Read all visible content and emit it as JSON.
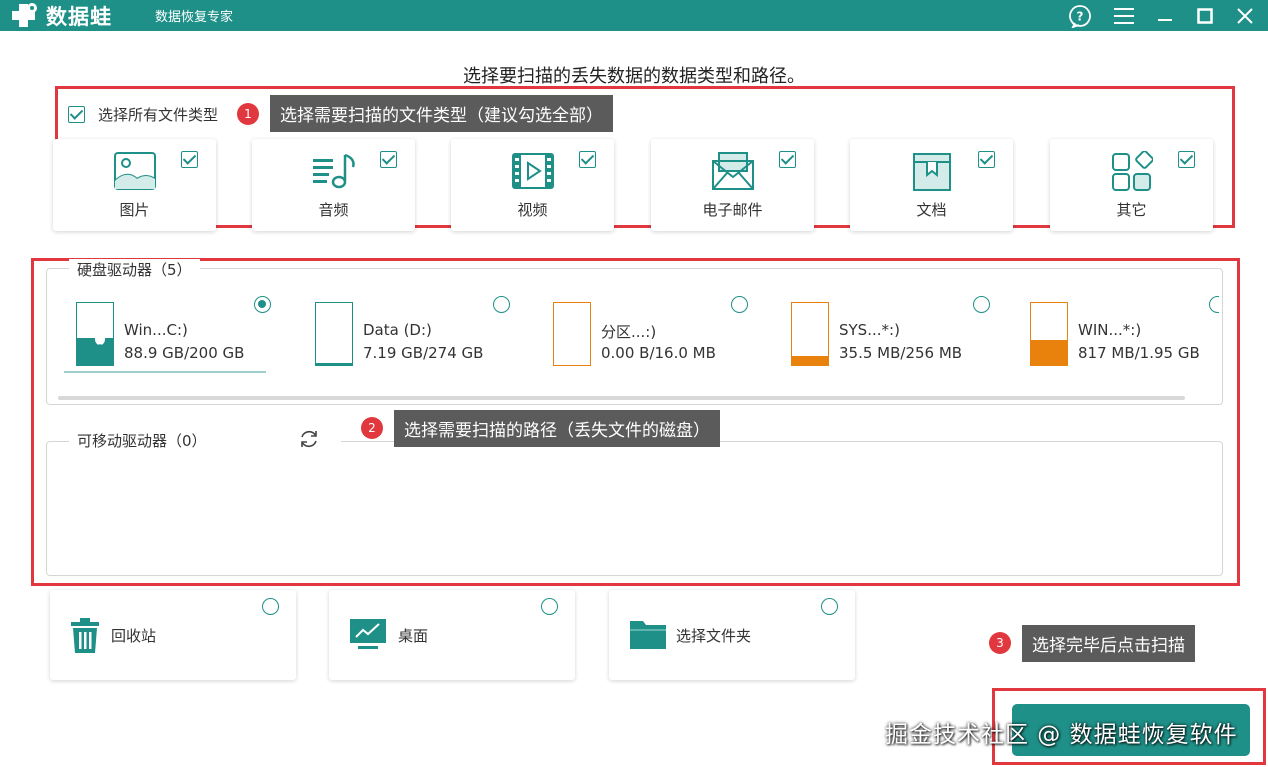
{
  "app": {
    "logo_text": "数据蛙",
    "subtitle": "数据恢复专家"
  },
  "heading": "选择要扫描的丢失数据的数据类型和路径。",
  "file_types": {
    "select_all_label": "选择所有文件类型",
    "select_all_checked": true,
    "items": [
      {
        "label": "图片",
        "icon": "image-icon",
        "checked": true
      },
      {
        "label": "音频",
        "icon": "audio-icon",
        "checked": true
      },
      {
        "label": "视频",
        "icon": "video-icon",
        "checked": true
      },
      {
        "label": "电子邮件",
        "icon": "email-icon",
        "checked": true
      },
      {
        "label": "文档",
        "icon": "document-icon",
        "checked": true
      },
      {
        "label": "其它",
        "icon": "other-icon",
        "checked": true
      }
    ]
  },
  "hard_drives": {
    "title": "硬盘驱动器（5）",
    "items": [
      {
        "name": "Win...C:)",
        "size": "88.9 GB/200 GB",
        "used_fraction": 0.44,
        "color": "#1e9088",
        "selected": true
      },
      {
        "name": "Data (D:)",
        "size": "7.19 GB/274 GB",
        "used_fraction": 0.03,
        "color": "#1e9088",
        "selected": false
      },
      {
        "name": "分区...:)",
        "size": "0.00  B/16.0 MB",
        "used_fraction": 0.0,
        "color": "#e8820c",
        "selected": false
      },
      {
        "name": "SYS...*:)",
        "size": "35.5 MB/256 MB",
        "used_fraction": 0.14,
        "color": "#e8820c",
        "selected": false
      },
      {
        "name": "WIN...*:)",
        "size": "817 MB/1.95 GB",
        "used_fraction": 0.41,
        "color": "#e8820c",
        "selected": false
      }
    ]
  },
  "removable": {
    "title": "可移动驱动器（0）"
  },
  "locations": [
    {
      "label": "回收站",
      "icon": "recycle-bin-icon"
    },
    {
      "label": "桌面",
      "icon": "desktop-icon"
    },
    {
      "label": "选择文件夹",
      "icon": "folder-icon"
    }
  ],
  "annotations": {
    "step1": {
      "number": "1",
      "text": "选择需要扫描的文件类型（建议勾选全部）"
    },
    "step2": {
      "number": "2",
      "text": "选择需要扫描的路径（丢失文件的磁盘）"
    },
    "step3": {
      "number": "3",
      "text": "选择完毕后点击扫描"
    }
  },
  "watermark": "掘金技术社区 @ 数据蛙恢复软件",
  "colors": {
    "brand": "#1e9088",
    "annotation_red": "#e0383e",
    "partition_orange": "#e8820c"
  }
}
